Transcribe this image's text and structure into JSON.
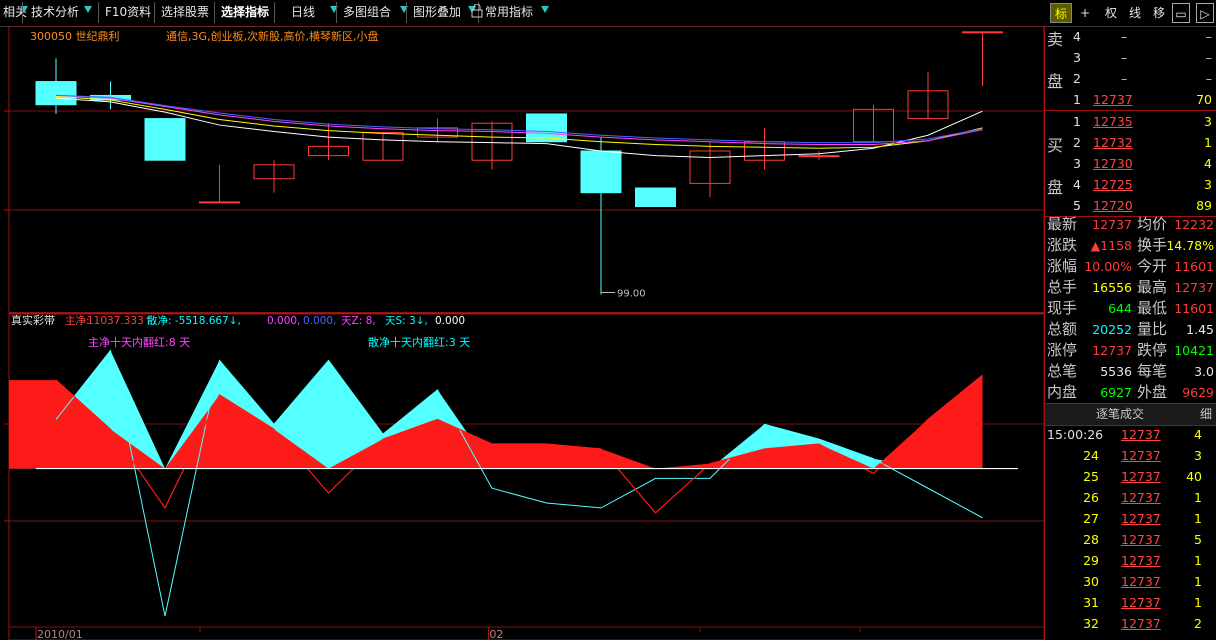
{
  "toolbar": {
    "items": [
      "相关",
      "技术分析",
      "F10资料",
      "选择股票",
      "选择指标",
      "日线",
      "多图组合",
      "图形叠加",
      "常用指标"
    ],
    "selected": "选择指标",
    "right_buttons": [
      "标",
      "+",
      "权",
      "线",
      "移",
      "▭",
      "▷"
    ],
    "active_right": "标"
  },
  "stock": {
    "code_name": "300050 世纪鼎利",
    "tags": "通信,3G,创业板,次新股,高价,横琴新区,小盘"
  },
  "chart_data": {
    "type": "candlestick",
    "candles": [
      {
        "o": 122.0,
        "c": 119.5,
        "h": 124.5,
        "l": 118.5
      },
      {
        "o": 120.5,
        "c": 120.0,
        "h": 122.0,
        "l": 119.0
      },
      {
        "o": 118.0,
        "c": 113.5,
        "h": 118.0,
        "l": 113.5
      },
      {
        "o": 109.0,
        "c": 109.0,
        "h": 113.0,
        "l": 109.0
      },
      {
        "o": 111.5,
        "c": 113.0,
        "h": 113.5,
        "l": 110.0
      },
      {
        "o": 114.0,
        "c": 115.0,
        "h": 117.5,
        "l": 113.5
      },
      {
        "o": 113.5,
        "c": 116.5,
        "h": 116.5,
        "l": 113.5
      },
      {
        "o": 116.0,
        "c": 117.0,
        "h": 118.0,
        "l": 115.5
      },
      {
        "o": 113.5,
        "c": 117.5,
        "h": 117.7,
        "l": 112.5
      },
      {
        "o": 118.5,
        "c": 115.5,
        "h": 118.5,
        "l": 115.5
      },
      {
        "o": 114.5,
        "c": 110.0,
        "h": 116.0,
        "l": 99.0
      },
      {
        "o": 110.5,
        "c": 108.5,
        "h": 110.5,
        "l": 108.5
      },
      {
        "o": 111.0,
        "c": 114.5,
        "h": 115.5,
        "l": 109.5
      },
      {
        "o": 113.5,
        "c": 115.5,
        "h": 117.0,
        "l": 112.5
      },
      {
        "o": 114.0,
        "c": 114.0,
        "h": 114.5,
        "l": 113.5
      },
      {
        "o": 115.5,
        "c": 119.0,
        "h": 119.5,
        "l": 115.5
      },
      {
        "o": 118.0,
        "c": 121.0,
        "h": 123.0,
        "l": 118.0
      },
      {
        "o": 127.37,
        "c": 127.37,
        "h": 127.37,
        "l": 121.5
      }
    ],
    "ma_series": [
      {
        "color": "#ffffff",
        "values": [
          120.2,
          119.8,
          118.7,
          117.3,
          116.6,
          116.0,
          115.7,
          115.5,
          115.4,
          115.3,
          114.5,
          114.0,
          113.8,
          114.0,
          114.2,
          114.8,
          116.2,
          118.8
        ]
      },
      {
        "color": "#ffff00",
        "values": [
          120.4,
          120.0,
          119.0,
          117.9,
          117.2,
          116.7,
          116.4,
          116.2,
          116.0,
          115.9,
          115.5,
          115.2,
          115.0,
          114.9,
          114.8,
          114.9,
          115.6,
          117.0
        ]
      },
      {
        "color": "#ff44ff",
        "values": [
          120.5,
          120.2,
          119.3,
          118.4,
          117.7,
          117.2,
          116.9,
          116.7,
          116.6,
          116.4,
          116.0,
          115.7,
          115.5,
          115.3,
          115.2,
          115.2,
          115.6,
          116.8
        ]
      },
      {
        "color": "#4466ff",
        "values": [
          120.5,
          120.3,
          119.4,
          118.6,
          117.9,
          117.4,
          117.1,
          116.9,
          116.8,
          116.6,
          116.2,
          115.9,
          115.7,
          115.5,
          115.4,
          115.4,
          115.8,
          116.9
        ]
      }
    ],
    "low_label": "99.00",
    "ylim": [
      97,
      128
    ],
    "x_labels": [
      {
        "i": 0,
        "text": "2010/01"
      },
      {
        "i": 8.3,
        "text": "02"
      }
    ],
    "indicator": {
      "name": "真实彩带",
      "header": [
        {
          "t": "主净:",
          "c": "#ff4040"
        },
        {
          "t": "11037.333↑,",
          "c": "#ff4040"
        },
        {
          "t": "散净: -5518.667↓,",
          "c": "#00ffff"
        },
        {
          "t": "0.000,",
          "c": "#ff44ff"
        },
        {
          "t": "0.000,",
          "c": "#4466ff"
        },
        {
          "t": "天Z: 8,",
          "c": "#ff44ff"
        },
        {
          "t": "天S: 3↓,",
          "c": "#00ffff"
        },
        {
          "t": "0.000",
          "c": "#ffffff"
        }
      ],
      "label_main": "主净十天内翻红:8 天",
      "label_retail": "散净十天内翻红:3 天",
      "main": [
        0.9,
        0.4,
        -0.4,
        0.75,
        0.4,
        -0.25,
        0.3,
        0.5,
        0.25,
        0.25,
        0.2,
        -0.45,
        0.05,
        0.2,
        0.25,
        -0.05,
        0.5,
        0.95
      ],
      "retail": [
        0.5,
        1.2,
        -1.5,
        1.1,
        0.45,
        1.1,
        0.35,
        0.8,
        -0.2,
        -0.35,
        -0.4,
        -0.1,
        -0.1,
        0.45,
        0.3,
        0.1,
        -0.2,
        -0.5
      ],
      "ylim": [
        -1.55,
        1.45
      ]
    }
  },
  "panel": {
    "sell_label": [
      "卖",
      "盘"
    ],
    "buy_label": [
      "买",
      "盘"
    ],
    "sell": [
      {
        "n": "4",
        "p": "–",
        "v": "–"
      },
      {
        "n": "3",
        "p": "–",
        "v": "–"
      },
      {
        "n": "2",
        "p": "–",
        "v": "–"
      },
      {
        "n": "1",
        "p": "12737",
        "v": "70"
      }
    ],
    "buy": [
      {
        "n": "1",
        "p": "12735",
        "v": "3"
      },
      {
        "n": "2",
        "p": "12732",
        "v": "1"
      },
      {
        "n": "3",
        "p": "12730",
        "v": "4"
      },
      {
        "n": "4",
        "p": "12725",
        "v": "3"
      },
      {
        "n": "5",
        "p": "12720",
        "v": "89"
      }
    ],
    "stats": [
      {
        "l1": "最新",
        "v1": "12737",
        "c1": "red",
        "l2": "均价",
        "v2": "12232",
        "c2": "red"
      },
      {
        "l1": "涨跌",
        "v1": "▲1158",
        "c1": "red",
        "l2": "换手",
        "v2": "14.78%",
        "c2": "yel"
      },
      {
        "l1": "涨幅",
        "v1": "10.00%",
        "c1": "red",
        "l2": "今开",
        "v2": "11601",
        "c2": "red"
      },
      {
        "l1": "总手",
        "v1": "16556",
        "c1": "yel",
        "l2": "最高",
        "v2": "12737",
        "c2": "red"
      },
      {
        "l1": "现手",
        "v1": "644",
        "c1": "grn",
        "l2": "最低",
        "v2": "11601",
        "c2": "red"
      },
      {
        "l1": "总额",
        "v1": "20252",
        "c1": "cyan",
        "l2": "量比",
        "v2": "1.45",
        "c2": "wht"
      },
      {
        "l1": "涨停",
        "v1": "12737",
        "c1": "red",
        "l2": "跌停",
        "v2": "10421",
        "c2": "grn"
      },
      {
        "l1": "总笔",
        "v1": "5536",
        "c1": "wht",
        "l2": "每笔",
        "v2": "3.0",
        "c2": "wht"
      },
      {
        "l1": "内盘",
        "v1": "6927",
        "c1": "grn",
        "l2": "外盘",
        "v2": "9629",
        "c2": "red"
      }
    ],
    "ticks_header": "逐笔成交",
    "ticks_detail": "细",
    "ticks": [
      {
        "t": "15:00:26",
        "p": "12737",
        "v": "4"
      },
      {
        "t": "24",
        "p": "12737",
        "v": "3"
      },
      {
        "t": "25",
        "p": "12737",
        "v": "40"
      },
      {
        "t": "26",
        "p": "12737",
        "v": "1"
      },
      {
        "t": "27",
        "p": "12737",
        "v": "1"
      },
      {
        "t": "28",
        "p": "12737",
        "v": "5"
      },
      {
        "t": "29",
        "p": "12737",
        "v": "1"
      },
      {
        "t": "30",
        "p": "12737",
        "v": "1"
      },
      {
        "t": "31",
        "p": "12737",
        "v": "1"
      },
      {
        "t": "32",
        "p": "12737",
        "v": "2"
      }
    ]
  }
}
